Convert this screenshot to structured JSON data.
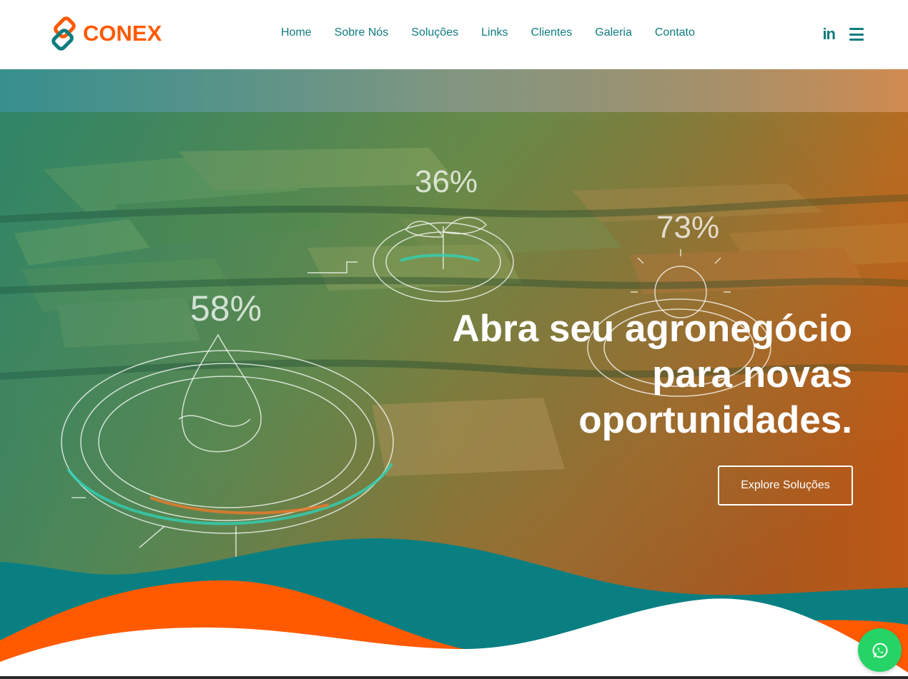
{
  "brand": {
    "name": "CONEX",
    "primary_color": "#0e7c7f",
    "accent_color": "#ff5a00"
  },
  "nav": {
    "items": [
      {
        "label": "Home"
      },
      {
        "label": "Sobre Nós"
      },
      {
        "label": "Soluções"
      },
      {
        "label": "Links"
      },
      {
        "label": "Clientes"
      },
      {
        "label": "Galeria"
      },
      {
        "label": "Contato"
      }
    ]
  },
  "header_icons": {
    "linkedin": "in",
    "linkedin_icon": "linkedin-icon",
    "menu_icon": "hamburger-menu-icon"
  },
  "hero": {
    "title": "Abra seu agronegócio para novas oportunidades.",
    "button_label": "Explore Soluções",
    "overlay_stats": [
      "36%",
      "73%",
      "58%"
    ]
  },
  "floating": {
    "whatsapp_icon": "whatsapp-icon"
  }
}
